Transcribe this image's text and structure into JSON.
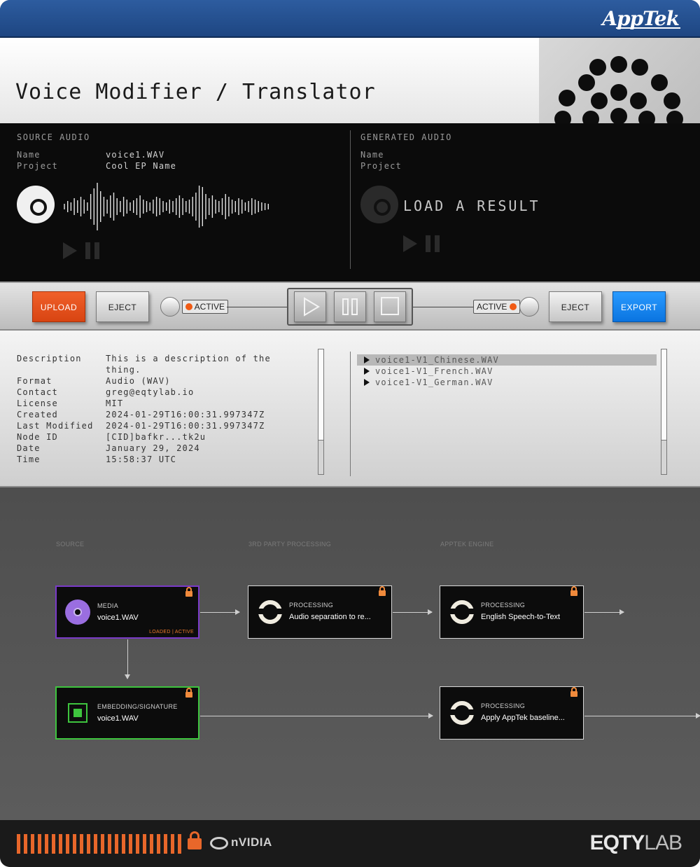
{
  "brand": {
    "logo_text": "AppTek"
  },
  "title": "Voice Modifier / Translator",
  "source_audio": {
    "heading": "SOURCE AUDIO",
    "name_label": "Name",
    "name_value": "voice1.WAV",
    "project_label": "Project",
    "project_value": "Cool EP Name"
  },
  "generated_audio": {
    "heading": "GENERATED AUDIO",
    "name_label": "Name",
    "project_label": "Project",
    "placeholder": "LOAD A RESULT"
  },
  "controls": {
    "upload_label": "UPLOAD",
    "eject_left_label": "EJECT",
    "active_left_label": "ACTIVE",
    "active_right_label": "ACTIVE",
    "eject_right_label": "EJECT",
    "export_label": "EXPORT"
  },
  "details": [
    {
      "label": "Description",
      "value": "This is a description of the"
    },
    {
      "label": "",
      "value": "thing."
    },
    {
      "label": "Format",
      "value": "Audio (WAV)"
    },
    {
      "label": "Contact",
      "value": "greg@eqtylab.io"
    },
    {
      "label": "License",
      "value": "MIT"
    },
    {
      "label": "Created",
      "value": "2024-01-29T16:00:31.997347Z"
    },
    {
      "label": "Last Modified",
      "value": "2024-01-29T16:00:31.997347Z"
    },
    {
      "label": "Node ID",
      "value": "[CID]bafkr...tk2u"
    },
    {
      "label": "Date",
      "value": "January 29, 2024"
    },
    {
      "label": "Time",
      "value": "15:58:37 UTC"
    }
  ],
  "results": [
    "voice1-V1_Chinese.WAV",
    "voice1-V1_French.WAV",
    "voice1-V1_German.WAV"
  ],
  "flow": {
    "columns": [
      "SOURCE",
      "3RD PARTY PROCESSING",
      "APPTEK ENGINE"
    ],
    "nodes": {
      "media": {
        "kind": "MEDIA",
        "name": "voice1.WAV",
        "status": "LOADED | ACTIVE"
      },
      "separation": {
        "kind": "PROCESSING",
        "name": "Audio separation to re..."
      },
      "stt": {
        "kind": "PROCESSING",
        "name": "English Speech-to-Text"
      },
      "embedding": {
        "kind": "EMBEDDING/SIGNATURE",
        "name": "voice1.WAV"
      },
      "baseline": {
        "kind": "PROCESSING",
        "name": "Apply AppTek baseline..."
      }
    }
  },
  "footer": {
    "partner_text": "nVIDIA",
    "eqty_bold": "EQTY",
    "eqty_light": "LAB"
  },
  "colors": {
    "header_blue": "#2d5c9f",
    "upload_orange": "#f0602a",
    "export_blue": "#2a9bff",
    "media_border": "#7a3ac8",
    "embedding_border": "#3ec43e",
    "accent_orange": "#e8672a"
  }
}
